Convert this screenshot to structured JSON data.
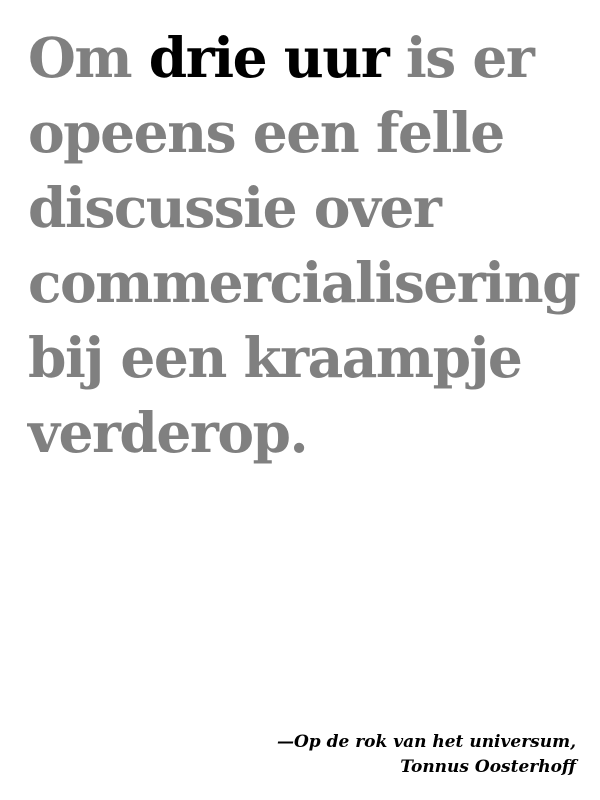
{
  "quote": {
    "line1_before": "Om ",
    "line1_emphasis": "drie uur",
    "line1_after": " is er",
    "line2": "opeens een felle",
    "line3": "discussie over",
    "line4": "commercialisering",
    "line5": "bij een kraampje",
    "line6": "verderop."
  },
  "attribution": {
    "source": "—Op de rok van het universum,",
    "author": "Tonnus Oosterhoff"
  },
  "colors": {
    "quote_text": "#808080",
    "emphasis_text": "#000000",
    "attribution_text": "#000000",
    "background": "#ffffff"
  }
}
